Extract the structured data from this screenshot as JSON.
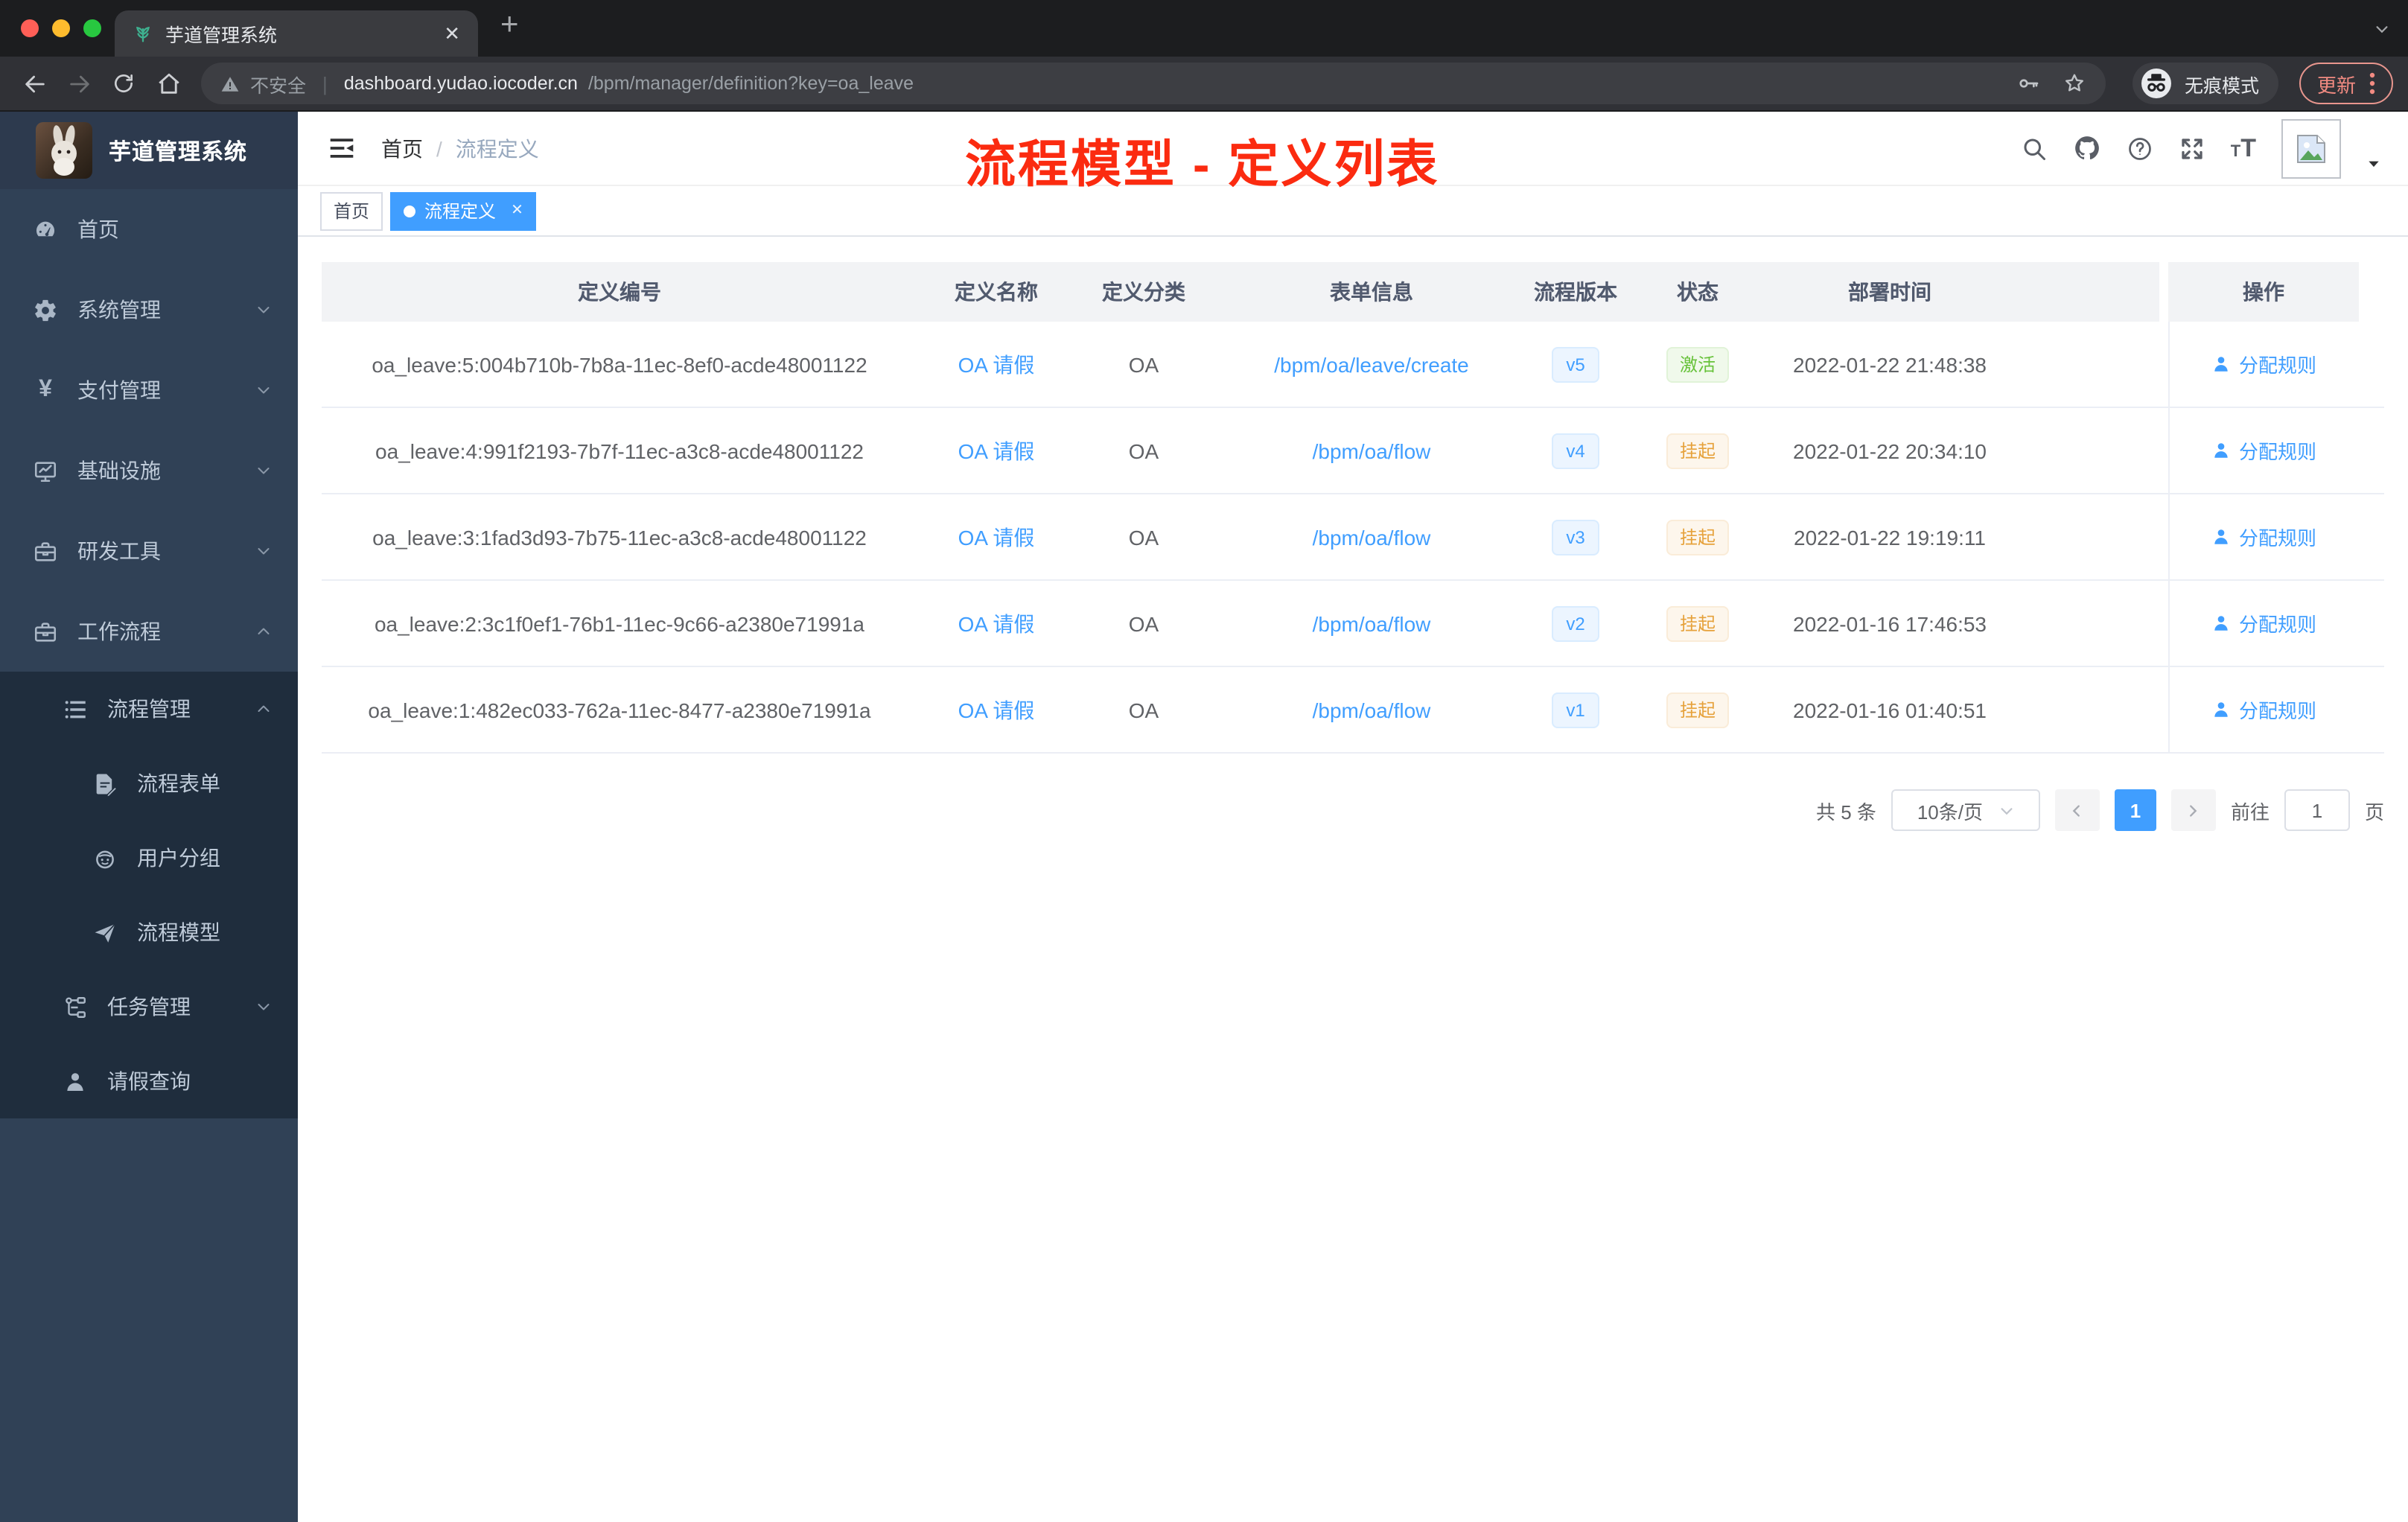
{
  "browser": {
    "tab_title": "芋道管理系统",
    "security_warning": "不安全",
    "url_host": "dashboard.yudao.iocoder.cn",
    "url_path": "/bpm/manager/definition?key=oa_leave",
    "incognito_label": "无痕模式",
    "update_label": "更新"
  },
  "sidebar": {
    "app_title": "芋道管理系统",
    "menu": [
      {
        "key": "home",
        "label": "首页",
        "icon": "dashboard-icon",
        "chevron": null
      },
      {
        "key": "system",
        "label": "系统管理",
        "icon": "gear-icon",
        "chevron": "down"
      },
      {
        "key": "payment",
        "label": "支付管理",
        "icon": "yen-icon",
        "chevron": "down"
      },
      {
        "key": "infrastructure",
        "label": "基础设施",
        "icon": "monitor-icon",
        "chevron": "down"
      },
      {
        "key": "dev-tools",
        "label": "研发工具",
        "icon": "toolbox-icon",
        "chevron": "down"
      },
      {
        "key": "workflow",
        "label": "工作流程",
        "icon": "briefcase-icon",
        "chevron": "up"
      }
    ],
    "submenu": [
      {
        "key": "process-management",
        "label": "流程管理",
        "icon": "list-icon",
        "chevron": "up",
        "level": 2
      },
      {
        "key": "process-form",
        "label": "流程表单",
        "icon": "form-icon",
        "chevron": null,
        "level": 3
      },
      {
        "key": "user-group",
        "label": "用户分组",
        "icon": "robot-icon",
        "chevron": null,
        "level": 3
      },
      {
        "key": "process-model",
        "label": "流程模型",
        "icon": "send-icon",
        "chevron": null,
        "level": 3
      },
      {
        "key": "task-management",
        "label": "任务管理",
        "icon": "tree-icon",
        "chevron": "down",
        "level": 2
      },
      {
        "key": "leave-query",
        "label": "请假查询",
        "icon": "user-icon",
        "chevron": null,
        "level": 2
      }
    ]
  },
  "header": {
    "breadcrumb_home": "首页",
    "breadcrumb_separator": "/",
    "breadcrumb_current": "流程定义",
    "annotation": "流程模型 - 定义列表",
    "annotation_color": "#fb2b10"
  },
  "tags": [
    {
      "label": "首页",
      "active": false
    },
    {
      "label": "流程定义",
      "active": true
    }
  ],
  "table": {
    "columns": [
      "定义编号",
      "定义名称",
      "定义分类",
      "表单信息",
      "流程版本",
      "状态",
      "部署时间",
      "操作"
    ],
    "action_label": "分配规则",
    "rows": [
      {
        "id": "oa_leave:5:004b710b-7b8a-11ec-8ef0-acde48001122",
        "name": "OA 请假",
        "category": "OA",
        "form": "/bpm/oa/leave/create",
        "version": "v5",
        "status": "激活",
        "status_type": "success",
        "deploy_time": "2022-01-22 21:48:38"
      },
      {
        "id": "oa_leave:4:991f2193-7b7f-11ec-a3c8-acde48001122",
        "name": "OA 请假",
        "category": "OA",
        "form": "/bpm/oa/flow",
        "version": "v4",
        "status": "挂起",
        "status_type": "warning",
        "deploy_time": "2022-01-22 20:34:10"
      },
      {
        "id": "oa_leave:3:1fad3d93-7b75-11ec-a3c8-acde48001122",
        "name": "OA 请假",
        "category": "OA",
        "form": "/bpm/oa/flow",
        "version": "v3",
        "status": "挂起",
        "status_type": "warning",
        "deploy_time": "2022-01-22 19:19:11"
      },
      {
        "id": "oa_leave:2:3c1f0ef1-76b1-11ec-9c66-a2380e71991a",
        "name": "OA 请假",
        "category": "OA",
        "form": "/bpm/oa/flow",
        "version": "v2",
        "status": "挂起",
        "status_type": "warning",
        "deploy_time": "2022-01-16 17:46:53"
      },
      {
        "id": "oa_leave:1:482ec033-762a-11ec-8477-a2380e71991a",
        "name": "OA 请假",
        "category": "OA",
        "form": "/bpm/oa/flow",
        "version": "v1",
        "status": "挂起",
        "status_type": "warning",
        "deploy_time": "2022-01-16 01:40:51"
      }
    ]
  },
  "pagination": {
    "total_label": "共 5 条",
    "page_size_label": "10条/页",
    "current_page": "1",
    "goto_label": "前往",
    "goto_value": "1",
    "page_unit_label": "页"
  },
  "colors": {
    "accent": "#409eff",
    "success": "#67c23a",
    "warning": "#e6a23c",
    "annotation_red": "#fb2b10",
    "sidebar_bg": "#304156",
    "submenu_bg": "#1f2d3d",
    "table_header_bg": "#f2f3f5"
  }
}
